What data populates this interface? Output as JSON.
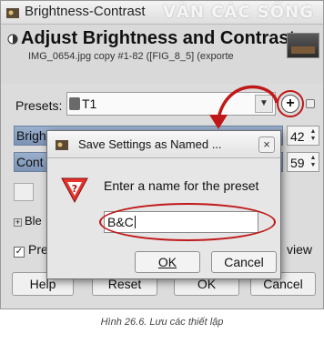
{
  "window": {
    "title": "Brightness-Contrast",
    "watermark": "VĂN CÁC SỐNG"
  },
  "header": {
    "title": "Adjust Brightness and Contrast",
    "subtitle": "IMG_0654.jpg copy #1-82 ([FIG_8_5] (exporte"
  },
  "presets": {
    "label": "Presets:",
    "selected": "T1"
  },
  "sliders": [
    {
      "label": "Brigh",
      "value": "42"
    },
    {
      "label": "Cont",
      "value": "59"
    }
  ],
  "options": {
    "blending_label": "Ble",
    "preview_label": "Pre",
    "split_view_label": "view"
  },
  "bottom_buttons": {
    "help": "Help",
    "reset": "Reset",
    "ok": "OK",
    "cancel": "Cancel"
  },
  "dialog": {
    "title": "Save Settings as Named ...",
    "prompt": "Enter a name for the preset",
    "input_value": "B&C",
    "ok_label": "OK",
    "cancel_label": "Cancel"
  },
  "caption": "Hình 26.6. Lưu các thiết lập",
  "colors": {
    "highlight_red": "#c01818",
    "slider_fill": "#8aa2c2"
  }
}
